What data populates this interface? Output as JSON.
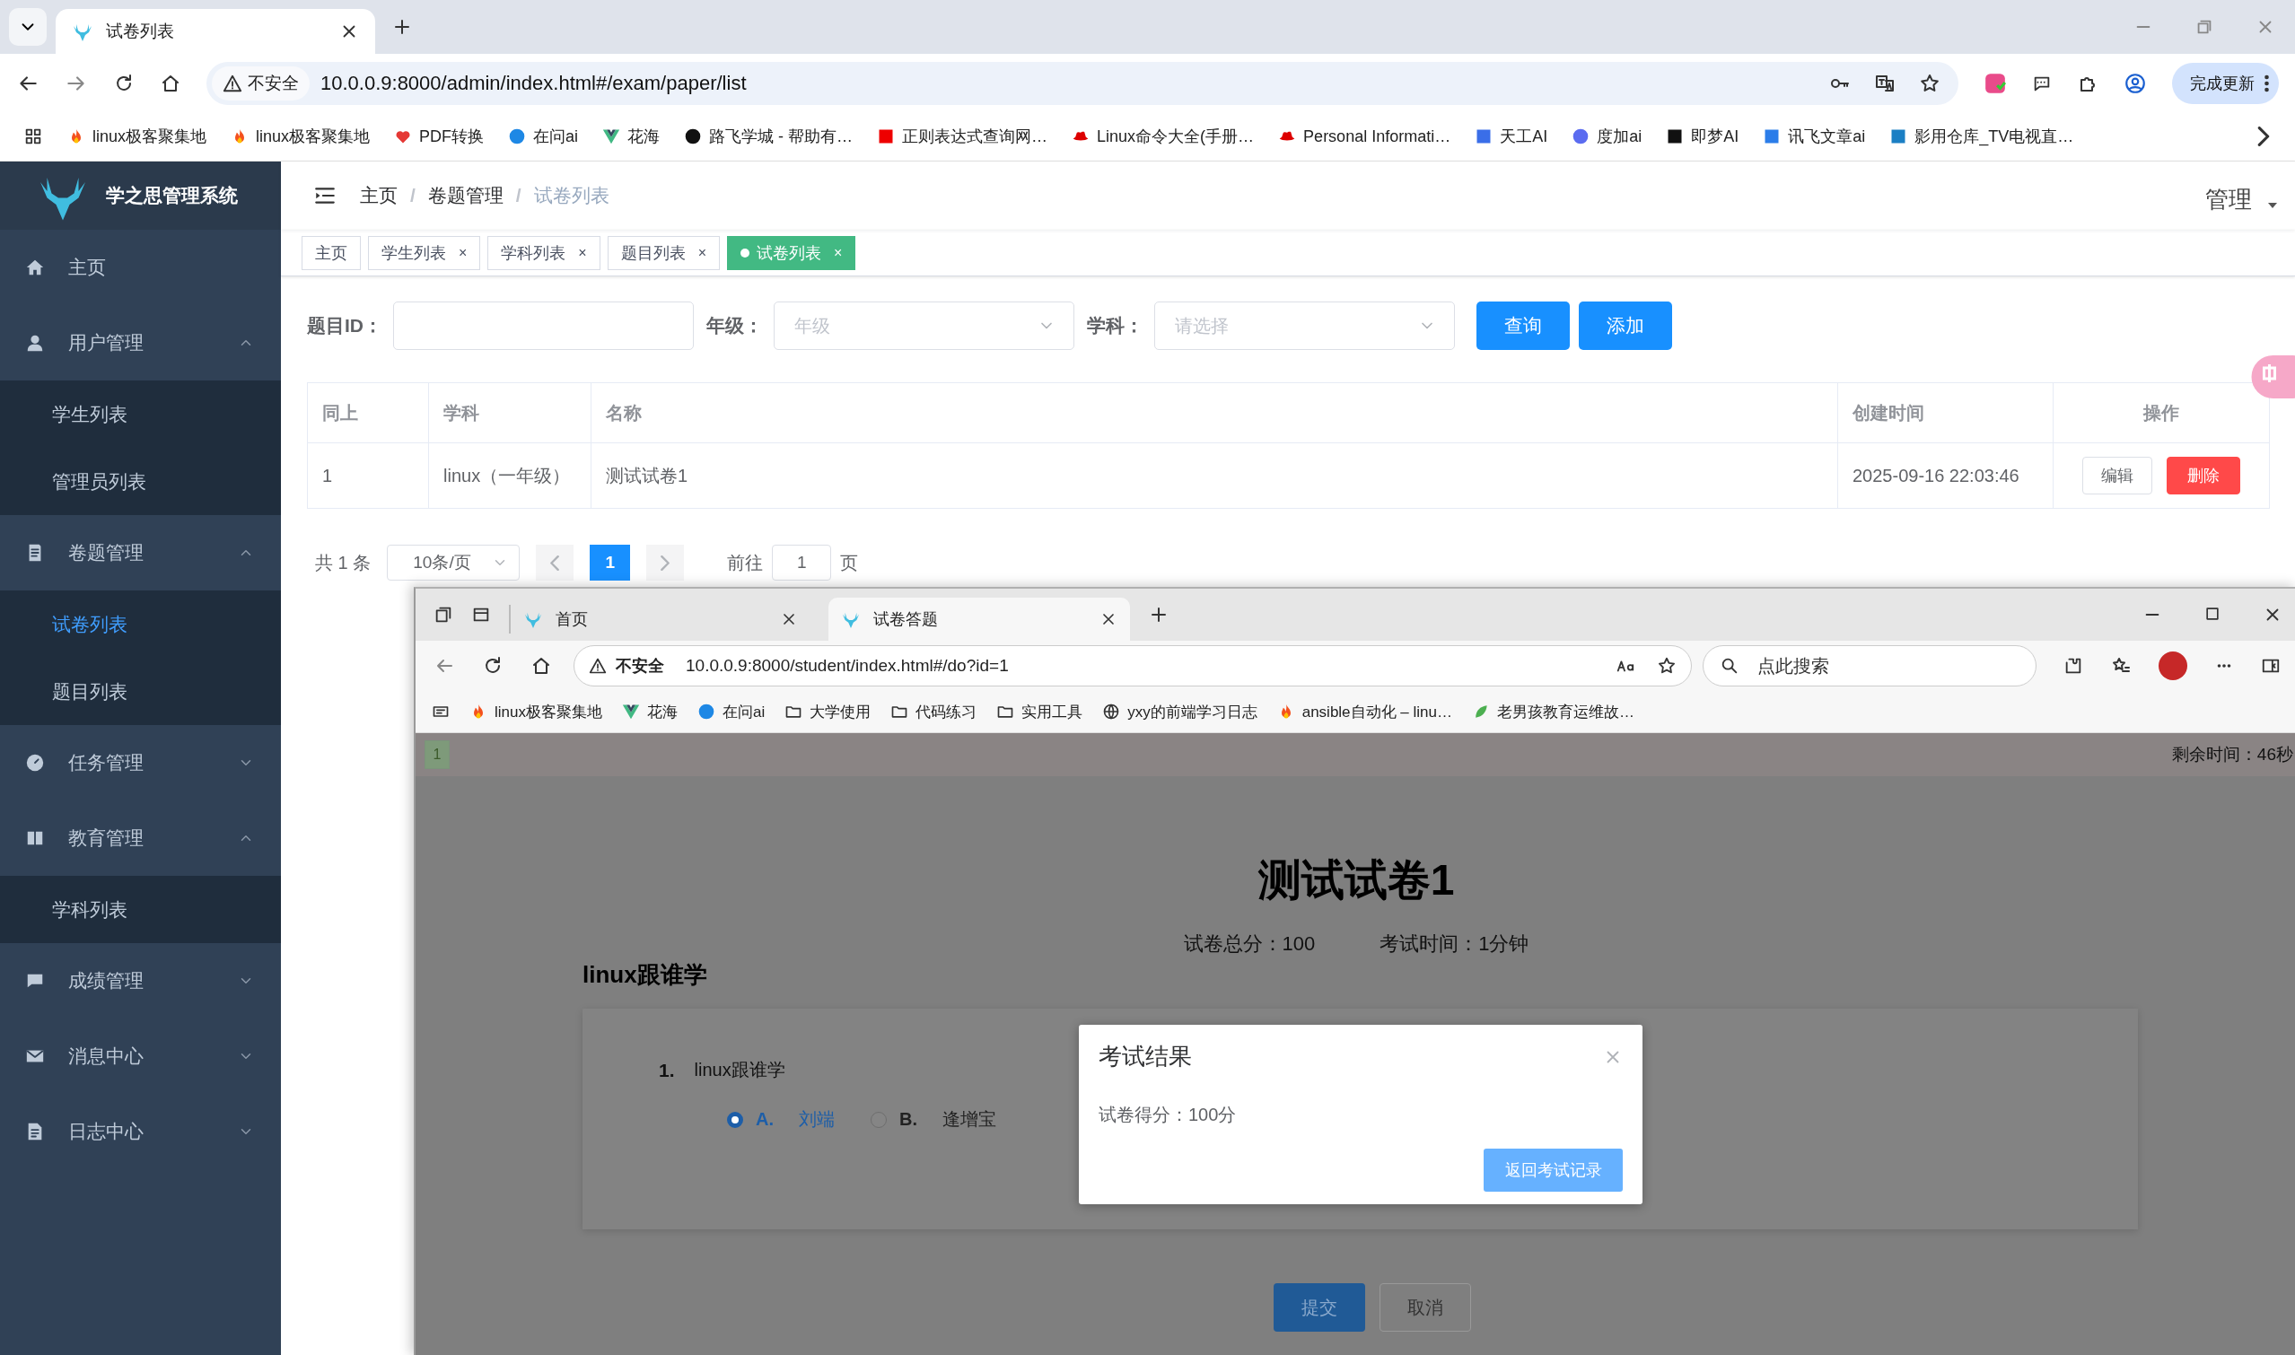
{
  "browser": {
    "tab": {
      "title": "试卷列表"
    },
    "url_warning": "不安全",
    "url": "10.0.0.9:8000/admin/index.html#/exam/paper/list",
    "update_button": "完成更新",
    "bookmarks": [
      {
        "label": "linux极客聚集地"
      },
      {
        "label": "linux极客聚集地"
      },
      {
        "label": "PDF转换"
      },
      {
        "label": "在问ai"
      },
      {
        "label": "花海"
      },
      {
        "label": "路飞学城 - 帮助有…"
      },
      {
        "label": "正则表达式查询网…"
      },
      {
        "label": "Linux命令大全(手册…"
      },
      {
        "label": "Personal Informati…"
      },
      {
        "label": "天工AI"
      },
      {
        "label": "度加ai"
      },
      {
        "label": "即梦AI"
      },
      {
        "label": "讯飞文章ai"
      },
      {
        "label": "影用仓库_TV电视直…"
      }
    ]
  },
  "app": {
    "logo_title": "学之思管理系统",
    "sidebar": [
      {
        "kind": "link",
        "label": "主页",
        "selected": false
      },
      {
        "kind": "group",
        "label": "用户管理",
        "expanded": true,
        "children": [
          {
            "label": "学生列表",
            "selected": false
          },
          {
            "label": "管理员列表",
            "selected": false
          }
        ]
      },
      {
        "kind": "group",
        "label": "卷题管理",
        "expanded": true,
        "children": [
          {
            "label": "试卷列表",
            "selected": true
          },
          {
            "label": "题目列表",
            "selected": false
          }
        ]
      },
      {
        "kind": "group",
        "label": "任务管理",
        "expanded": false
      },
      {
        "kind": "group",
        "label": "教育管理",
        "expanded": true,
        "children": [
          {
            "label": "学科列表",
            "selected": false
          }
        ]
      },
      {
        "kind": "group",
        "label": "成绩管理",
        "expanded": false
      },
      {
        "kind": "group",
        "label": "消息中心",
        "expanded": false
      },
      {
        "kind": "group",
        "label": "日志中心",
        "expanded": false
      }
    ],
    "breadcrumb": [
      "主页",
      "卷题管理",
      "试卷列表"
    ],
    "breadcrumb_separator": "/",
    "user_menu": "管理",
    "tags": [
      {
        "label": "主页",
        "selected": false
      },
      {
        "label": "学生列表",
        "selected": false,
        "close": "×"
      },
      {
        "label": "学科列表",
        "selected": false,
        "close": "×"
      },
      {
        "label": "题目列表",
        "selected": false,
        "close": "×"
      },
      {
        "label": "试卷列表",
        "selected": true,
        "close": "×"
      }
    ],
    "filters": [
      {
        "kind": "input",
        "label": "题目ID："
      },
      {
        "kind": "select",
        "label": "年级：",
        "placeholder": "年级"
      },
      {
        "kind": "select",
        "label": "学科：",
        "placeholder": "请选择"
      }
    ],
    "buttons": [
      "查询",
      "添加"
    ],
    "table": {
      "columns": [
        "同上",
        "学科",
        "名称",
        "创建时间",
        "操作"
      ],
      "rows": [
        {
          "cells": [
            "1",
            "linux（一年级）",
            "测试试卷1",
            "2025-09-16 22:03:46"
          ],
          "actions": [
            {
              "label": "编辑",
              "kind": "default"
            },
            {
              "label": "删除",
              "kind": "danger"
            }
          ]
        }
      ]
    },
    "pagination": {
      "total": "共 1 条",
      "page_size": "10条/页",
      "pages": [
        {
          "label": "1",
          "selected": true
        }
      ],
      "goto_label": "前往",
      "goto_value": "1",
      "page_suffix": "页"
    }
  },
  "student_window": {
    "tabs": [
      {
        "title": "首页",
        "selected": false
      },
      {
        "title": "试卷答题",
        "selected": true
      }
    ],
    "url_warning": "不安全",
    "url": "10.0.0.9:8000/student/index.html#/do?id=1",
    "search": {
      "placeholder": "点此搜索"
    },
    "bookmarks": [
      {
        "label": "linux极客聚集地"
      },
      {
        "label": "花海"
      },
      {
        "label": "在问ai"
      },
      {
        "label": "大学使用"
      },
      {
        "label": "代码练习"
      },
      {
        "label": "实用工具"
      },
      {
        "label": "yxy的前端学习日志"
      },
      {
        "label": "ansible自动化 – linu…"
      },
      {
        "label": "老男孩教育运维故…"
      }
    ],
    "page": {
      "question_nav": [
        {
          "label": "1",
          "answered": true
        }
      ],
      "remaining_time": "剩余时间：46秒",
      "title": "测试试卷1",
      "total_score": "试卷总分：100",
      "duration": "考试时间：1分钟",
      "section": "linux跟谁学",
      "questions": [
        {
          "number": "1.",
          "text": "linux跟谁学",
          "options": [
            {
              "letter": "A.",
              "text": "刘端",
              "selected": true
            },
            {
              "letter": "B.",
              "text": "逢增宝",
              "selected": false
            }
          ]
        }
      ],
      "submit": "提交",
      "cancel": "取消"
    },
    "dialog": {
      "title": "考试结果",
      "message": "试卷得分：100分",
      "button": "返回考试记录"
    }
  }
}
